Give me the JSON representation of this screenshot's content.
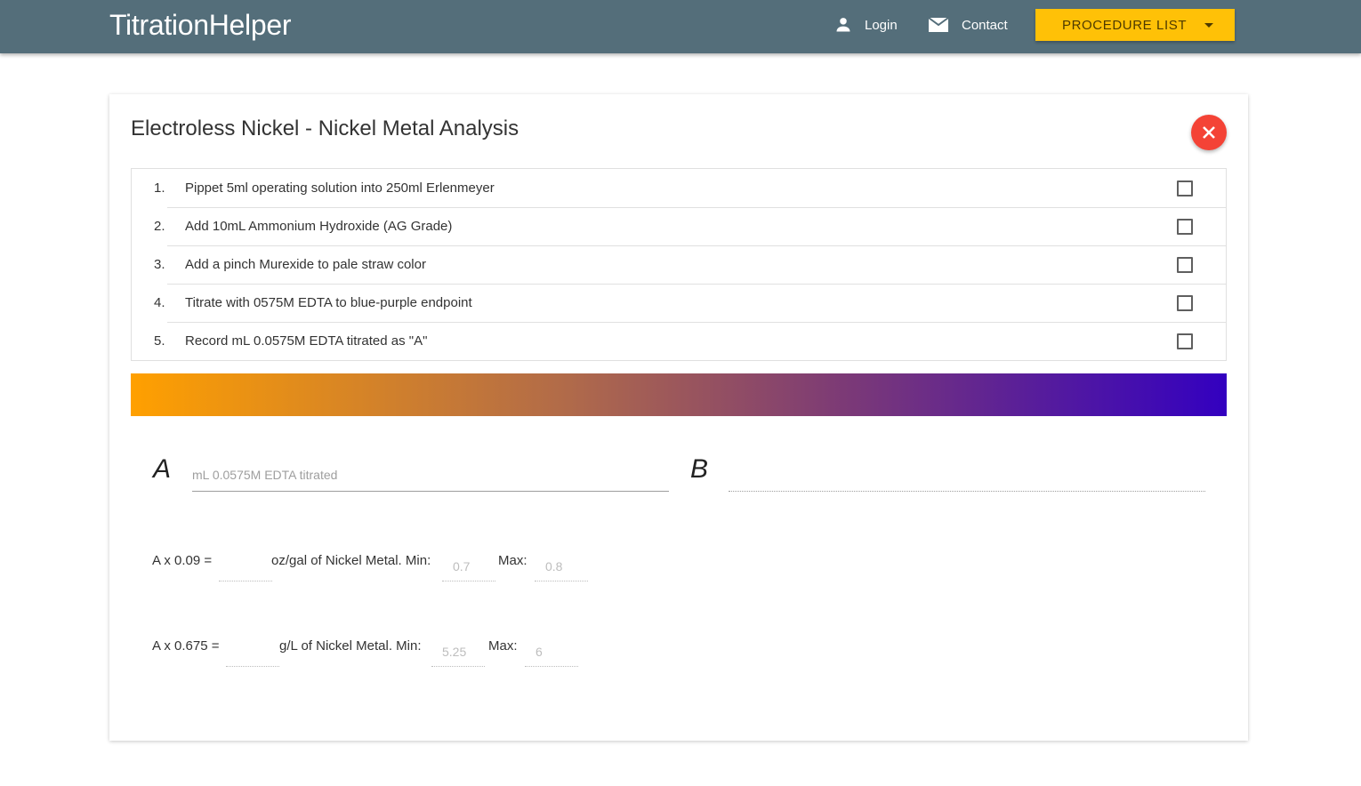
{
  "navbar": {
    "brand": "TitrationHelper",
    "login_label": "Login",
    "contact_label": "Contact",
    "procedure_button_label": "PROCEDURE LIST"
  },
  "procedure": {
    "title": "Electroless Nickel - Nickel Metal Analysis",
    "steps": [
      {
        "number": "1.",
        "text": "Pippet 5ml operating solution into 250ml Erlenmeyer",
        "checked": false
      },
      {
        "number": "2.",
        "text": "Add 10mL Ammonium Hydroxide (AG Grade)",
        "checked": false
      },
      {
        "number": "3.",
        "text": "Add a pinch Murexide to pale straw color",
        "checked": false
      },
      {
        "number": "4.",
        "text": "Titrate with 0575M EDTA to blue-purple endpoint",
        "checked": false
      },
      {
        "number": "5.",
        "text": "Record mL 0.0575M EDTA titrated as \"A\"",
        "checked": false
      }
    ],
    "endpoint_gradient": {
      "start_color": "#ffa000",
      "end_color": "#3300c0"
    }
  },
  "variables": {
    "a_label": "A",
    "a_placeholder": "mL 0.0575M EDTA titrated",
    "a_value": "",
    "b_label": "B",
    "b_value": ""
  },
  "calculations": [
    {
      "formula": "A x 0.09 =",
      "result": "",
      "unit_label": "oz/gal of Nickel Metal. Min:",
      "min": "0.7",
      "max_label": "Max:",
      "max": "0.8"
    },
    {
      "formula": "A x 0.675 =",
      "result": "",
      "unit_label": "g/L of Nickel Metal. Min:",
      "min": "5.25",
      "max_label": "Max:",
      "max": "6"
    }
  ],
  "colors": {
    "navbar": "#546e7a",
    "accent": "#ffc107",
    "close": "#f44336"
  }
}
